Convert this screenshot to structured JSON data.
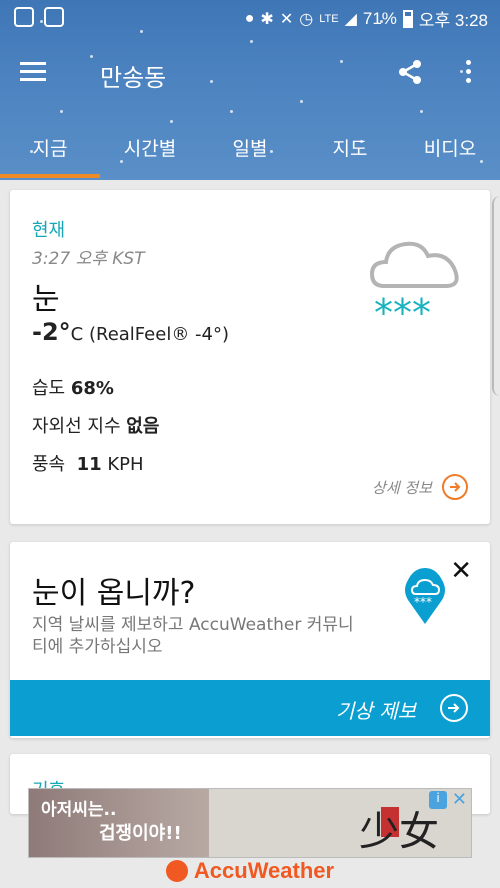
{
  "status_bar": {
    "network": "LTE",
    "battery": "71%",
    "time": "오후 3:28"
  },
  "toolbar": {
    "title": "만송동"
  },
  "tabs": [
    {
      "label": "지금",
      "active": true
    },
    {
      "label": "시간별",
      "active": false
    },
    {
      "label": "일별",
      "active": false
    },
    {
      "label": "지도",
      "active": false
    },
    {
      "label": "비디오",
      "active": false
    }
  ],
  "current": {
    "label": "현재",
    "time": "3:27 오후 KST",
    "condition": "눈",
    "temp": "-2°",
    "temp_unit": "C",
    "realfeel": "(RealFeel® -4°)",
    "humidity_label": "습도",
    "humidity_value": "68%",
    "uv_label": "자외선 지수",
    "uv_value": "없음",
    "wind_label": "풍속",
    "wind_value": "11",
    "wind_unit": "KPH",
    "more_label": "상세 정보"
  },
  "report": {
    "title": "눈이 옵니까?",
    "description": "지역 날씨를 제보하고 AccuWeather 커뮤니티에 추가하십시오",
    "button_label": "기상 제보"
  },
  "peek": {
    "text": "기후"
  },
  "ad": {
    "line1": "아저씨는..",
    "line2": "겁쟁이야!!",
    "art_text": "少女",
    "info": "i"
  },
  "brand": {
    "name": "AccuWeather"
  },
  "colors": {
    "accent_teal": "#19a7b5",
    "accent_orange": "#f07b28",
    "report_blue": "#0a9fd0"
  }
}
